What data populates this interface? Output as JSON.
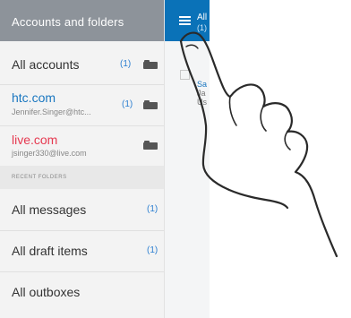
{
  "drawer": {
    "title": "Accounts and folders",
    "accounts": [
      {
        "name": "All accounts",
        "count": "(1)",
        "email": "",
        "color": "#333333"
      },
      {
        "name": "htc.com",
        "count": "(1)",
        "email": "Jennifer.Singer@htc...",
        "color": "#1a77c0"
      },
      {
        "name": "live.com",
        "count": "",
        "email": "jsinger330@live.com",
        "color": "#e63950"
      }
    ],
    "section_label": "RECENT FOLDERS",
    "folders": [
      {
        "name": "All messages",
        "count": "(1)"
      },
      {
        "name": "All draft items",
        "count": "(1)"
      },
      {
        "name": "All outboxes",
        "count": ""
      }
    ]
  },
  "right_panel": {
    "title": "All",
    "subtitle": "(1)",
    "sender": "Sa",
    "preview_line1": "Ja",
    "preview_line2": "Us"
  },
  "icons": {
    "menu": "hamburger-menu-icon",
    "folder": "folder-icon",
    "hand": "pointing-hand-icon"
  },
  "colors": {
    "header_gray": "#8d939a",
    "header_blue": "#0a72b8",
    "link_blue": "#1a77c0",
    "live_red": "#e63950"
  }
}
